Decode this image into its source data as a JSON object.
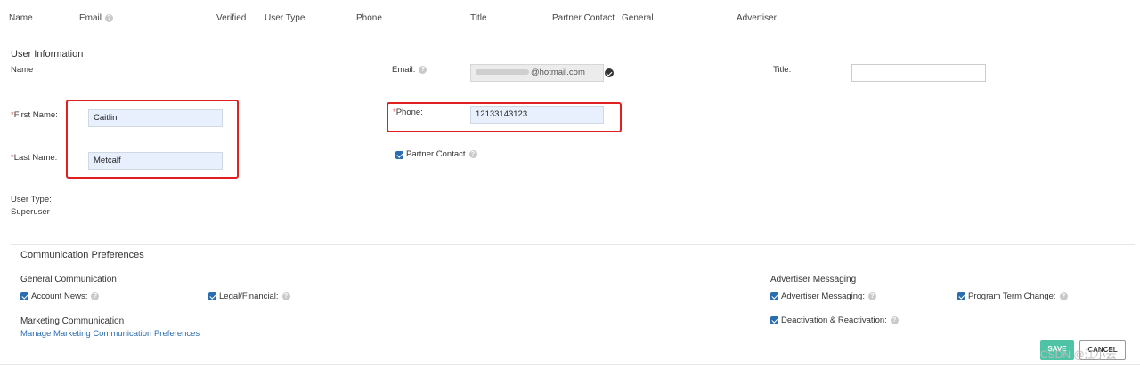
{
  "table_header": {
    "name": "Name",
    "email": "Email",
    "verified": "Verified",
    "user_type": "User Type",
    "phone": "Phone",
    "title": "Title",
    "partner_contact": "Partner Contact",
    "general": "General",
    "advertiser": "Advertiser"
  },
  "user_info": {
    "section_title": "User Information",
    "name_label": "Name",
    "email_label": "Email:",
    "email_value": "@hotmail.com",
    "title_label": "Title:",
    "title_value": "",
    "first_name_label": "First Name:",
    "first_name_value": "Caitlin",
    "last_name_label": "Last Name:",
    "last_name_value": "Metcalf",
    "phone_label": "Phone:",
    "phone_value": "12133143123",
    "partner_contact_label": "Partner Contact",
    "user_type_label": "User Type:",
    "user_type_value": "Superuser",
    "required_mark": "*"
  },
  "comm_prefs": {
    "section_title": "Communication Preferences",
    "general_title": "General Communication",
    "account_news": "Account News:",
    "legal_financial": "Legal/Financial:",
    "marketing_title": "Marketing Communication",
    "manage_link": "Manage Marketing Communication Preferences",
    "advertiser_title": "Advertiser Messaging",
    "advertiser_messaging": "Advertiser Messaging:",
    "program_term_change": "Program Term Change:",
    "deactivation": "Deactivation & Reactivation:"
  },
  "buttons": {
    "save": "SAVE",
    "cancel": "CANCEL"
  },
  "watermark": "CSDN @江小云",
  "icons": {
    "help": "?"
  },
  "colors": {
    "required": "#d9534f",
    "link": "#2a6db0",
    "save_button": "#4fc3a5",
    "highlight_box": "#e02020"
  }
}
